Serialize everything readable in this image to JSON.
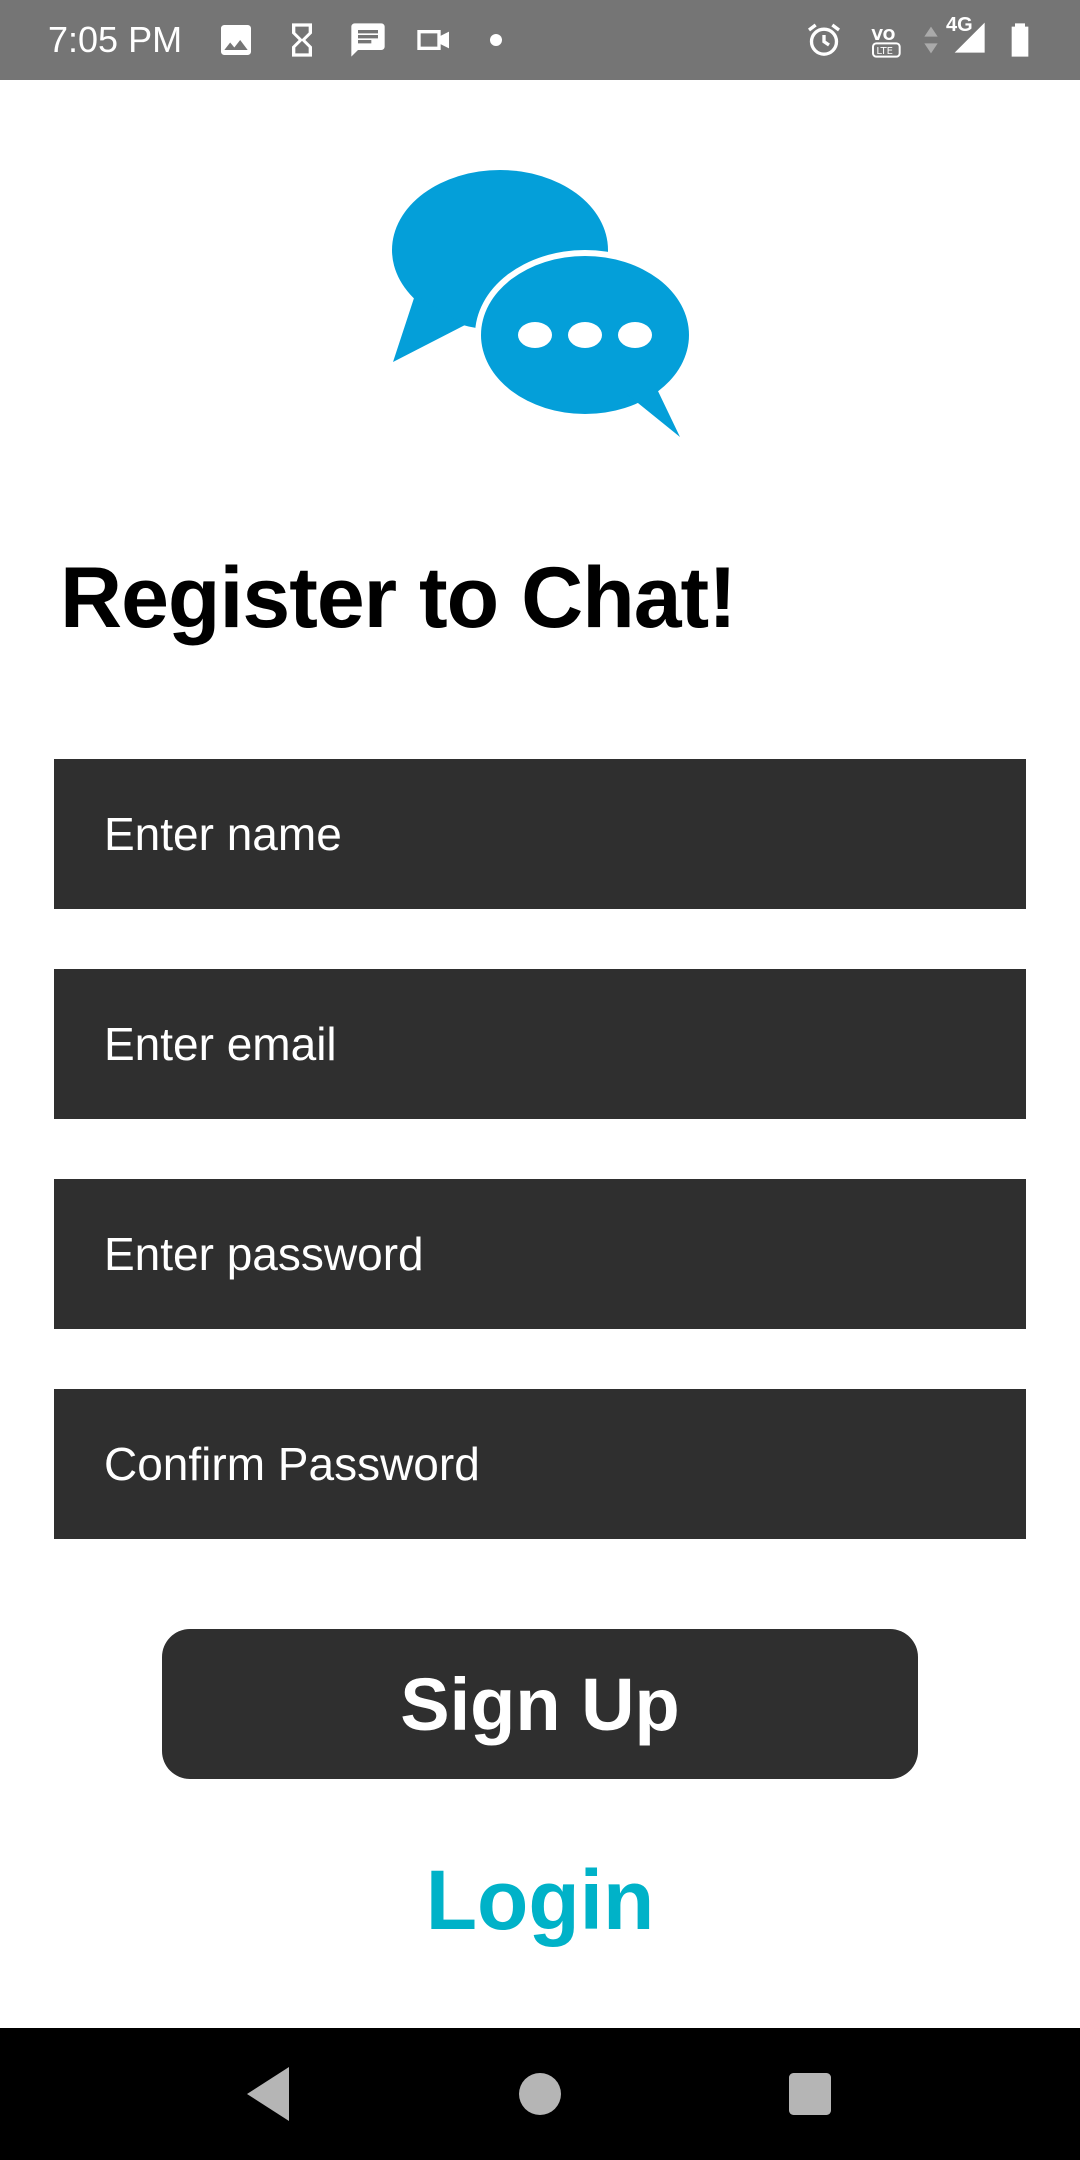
{
  "status_bar": {
    "time": "7:05 PM",
    "network_label": "4G",
    "volte_label": "VO LTE",
    "icons": [
      "image-icon",
      "hourglass-icon",
      "message-icon",
      "video-icon",
      "alarm-icon",
      "volte-icon",
      "signal-icon",
      "battery-icon"
    ]
  },
  "colors": {
    "accent": "#00b2c8",
    "logo_blue": "#049fd9",
    "field_bg": "#2f2f2f",
    "status_bar_bg": "#757575"
  },
  "page": {
    "title": "Register to Chat!"
  },
  "form": {
    "name_placeholder": "Enter name",
    "email_placeholder": "Enter email",
    "password_placeholder": "Enter password",
    "confirm_placeholder": "Confirm Password",
    "signup_label": "Sign Up",
    "login_label": "Login"
  },
  "nav_bar": {
    "icons": [
      "back-icon",
      "home-icon",
      "recents-icon"
    ]
  }
}
